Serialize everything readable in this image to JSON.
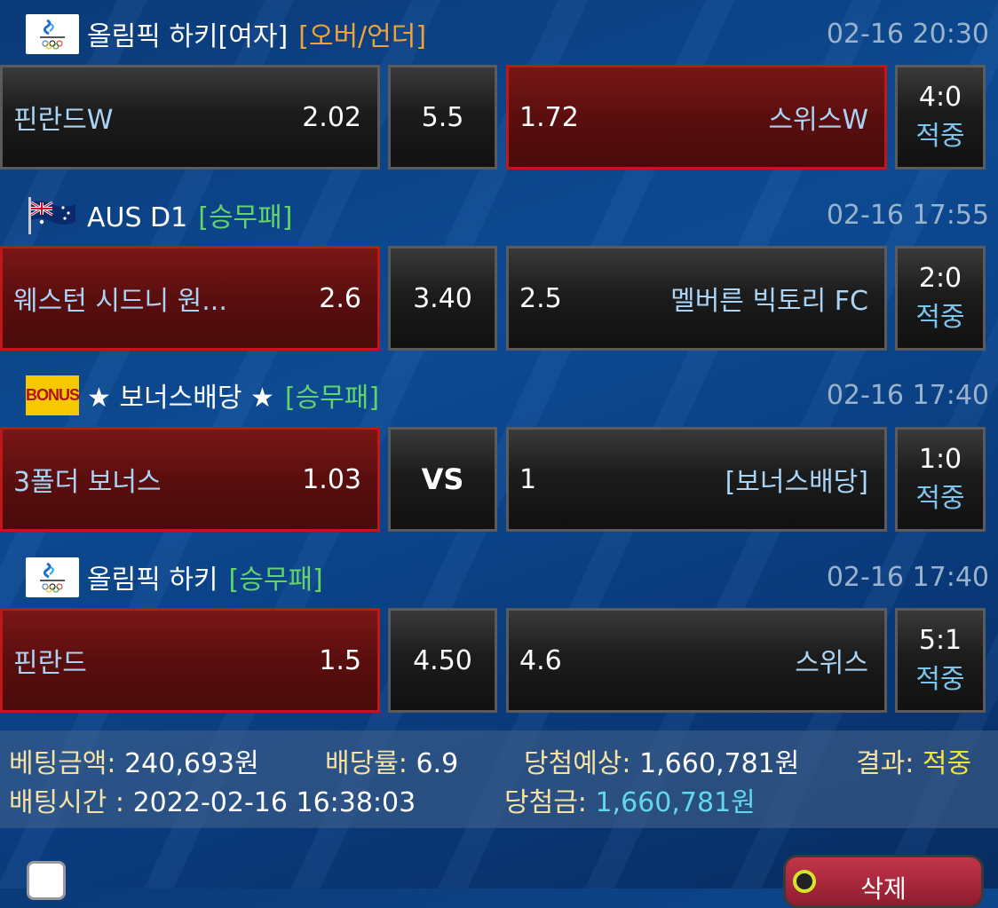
{
  "bets": [
    {
      "logo": "olympic-logo",
      "league": "올림픽 하키[여자]",
      "tag": "[오버/언더]",
      "tag_color": "#f0a23a",
      "time": "02-16 20:30",
      "home_team": "핀란드W",
      "home_odd": "2.02",
      "mid": "5.5",
      "away_odd": "1.72",
      "away_team": "스위스W",
      "score": "4:0",
      "status": "적중",
      "selected": "away"
    },
    {
      "logo": "australia-flag",
      "league": "AUS D1",
      "tag": "[승무패]",
      "tag_color": "#64d46a",
      "time": "02-16 17:55",
      "home_team": "웨스턴 시드니 원...",
      "home_odd": "2.6",
      "mid": "3.40",
      "away_odd": "2.5",
      "away_team": "멜버른 빅토리 FC",
      "score": "2:0",
      "status": "적중",
      "selected": "home"
    },
    {
      "logo": "bonus-logo",
      "logo_text": "BONUS",
      "league": "★ 보너스배당 ★",
      "tag": "[승무패]",
      "tag_color": "#64d46a",
      "time": "02-16 17:40",
      "home_team": "3폴더 보너스",
      "home_odd": "1.03",
      "mid": "VS",
      "away_odd": "1",
      "away_team": "[보너스배당]",
      "score": "1:0",
      "status": "적중",
      "selected": "home"
    },
    {
      "logo": "olympic-logo",
      "league": "올림픽 하키",
      "tag": "[승무패]",
      "tag_color": "#64d46a",
      "time": "02-16 17:40",
      "home_team": "핀란드",
      "home_odd": "1.5",
      "mid": "4.50",
      "away_odd": "4.6",
      "away_team": "스위스",
      "score": "5:1",
      "status": "적중",
      "selected": "home"
    }
  ],
  "summary": {
    "bet_amount_label": "베팅금액:",
    "bet_amount": "240,693원",
    "odds_label": "배당률:",
    "odds": "6.9",
    "expected_label": "당첨예상:",
    "expected": "1,660,781원",
    "result_label": "결과:",
    "result": "적중",
    "bet_time_label": "배팅시간 :",
    "bet_time": "2022-02-16 16:38:03",
    "win_label": "당첨금:",
    "win_amount": "1,660,781원"
  },
  "actions": {
    "delete_label": "삭제"
  }
}
